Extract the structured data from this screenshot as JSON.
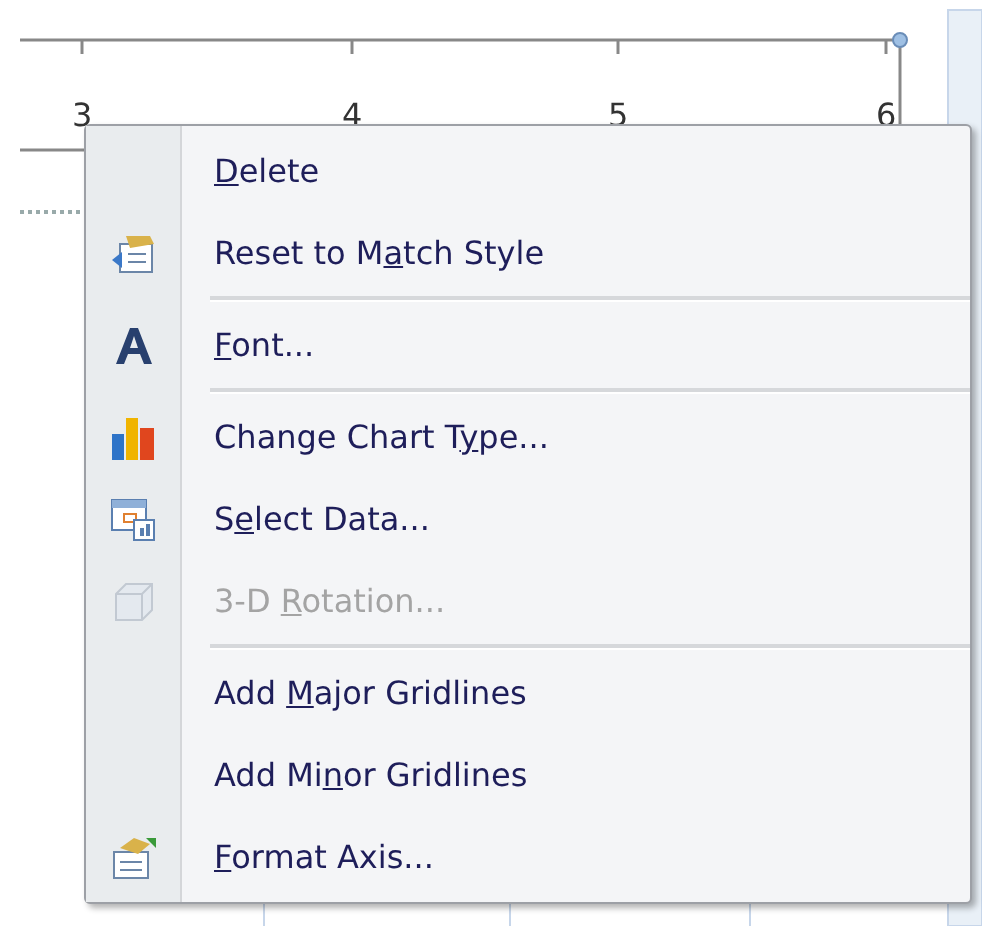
{
  "axis": {
    "tick_labels": [
      "3",
      "4",
      "5",
      "6"
    ]
  },
  "context_menu": {
    "items": [
      {
        "kind": "item",
        "access_key": "D",
        "label_end": "elete",
        "disabled": false
      },
      {
        "kind": "item",
        "label_start": "Reset to M",
        "access_key": "a",
        "label_end": "tch Style",
        "disabled": false
      },
      {
        "kind": "separator"
      },
      {
        "kind": "item",
        "access_key": "F",
        "label_end": "ont...",
        "disabled": false
      },
      {
        "kind": "separator"
      },
      {
        "kind": "item",
        "label_start": "Change Chart T",
        "access_key": "y",
        "label_end": "pe...",
        "disabled": false
      },
      {
        "kind": "item",
        "label_start": "S",
        "access_key": "e",
        "label_end": "lect Data...",
        "disabled": false
      },
      {
        "kind": "item",
        "label_start": "3-D ",
        "access_key": "R",
        "label_end": "otation...",
        "disabled": true
      },
      {
        "kind": "separator"
      },
      {
        "kind": "item",
        "label_start": "Add ",
        "access_key": "M",
        "label_end": "ajor Gridlines",
        "disabled": false
      },
      {
        "kind": "item",
        "label_start": "Add Mi",
        "access_key": "n",
        "label_end": "or Gridlines",
        "disabled": false
      },
      {
        "kind": "item",
        "access_key": "F",
        "label_end": "ormat Axis...",
        "disabled": false
      }
    ]
  }
}
